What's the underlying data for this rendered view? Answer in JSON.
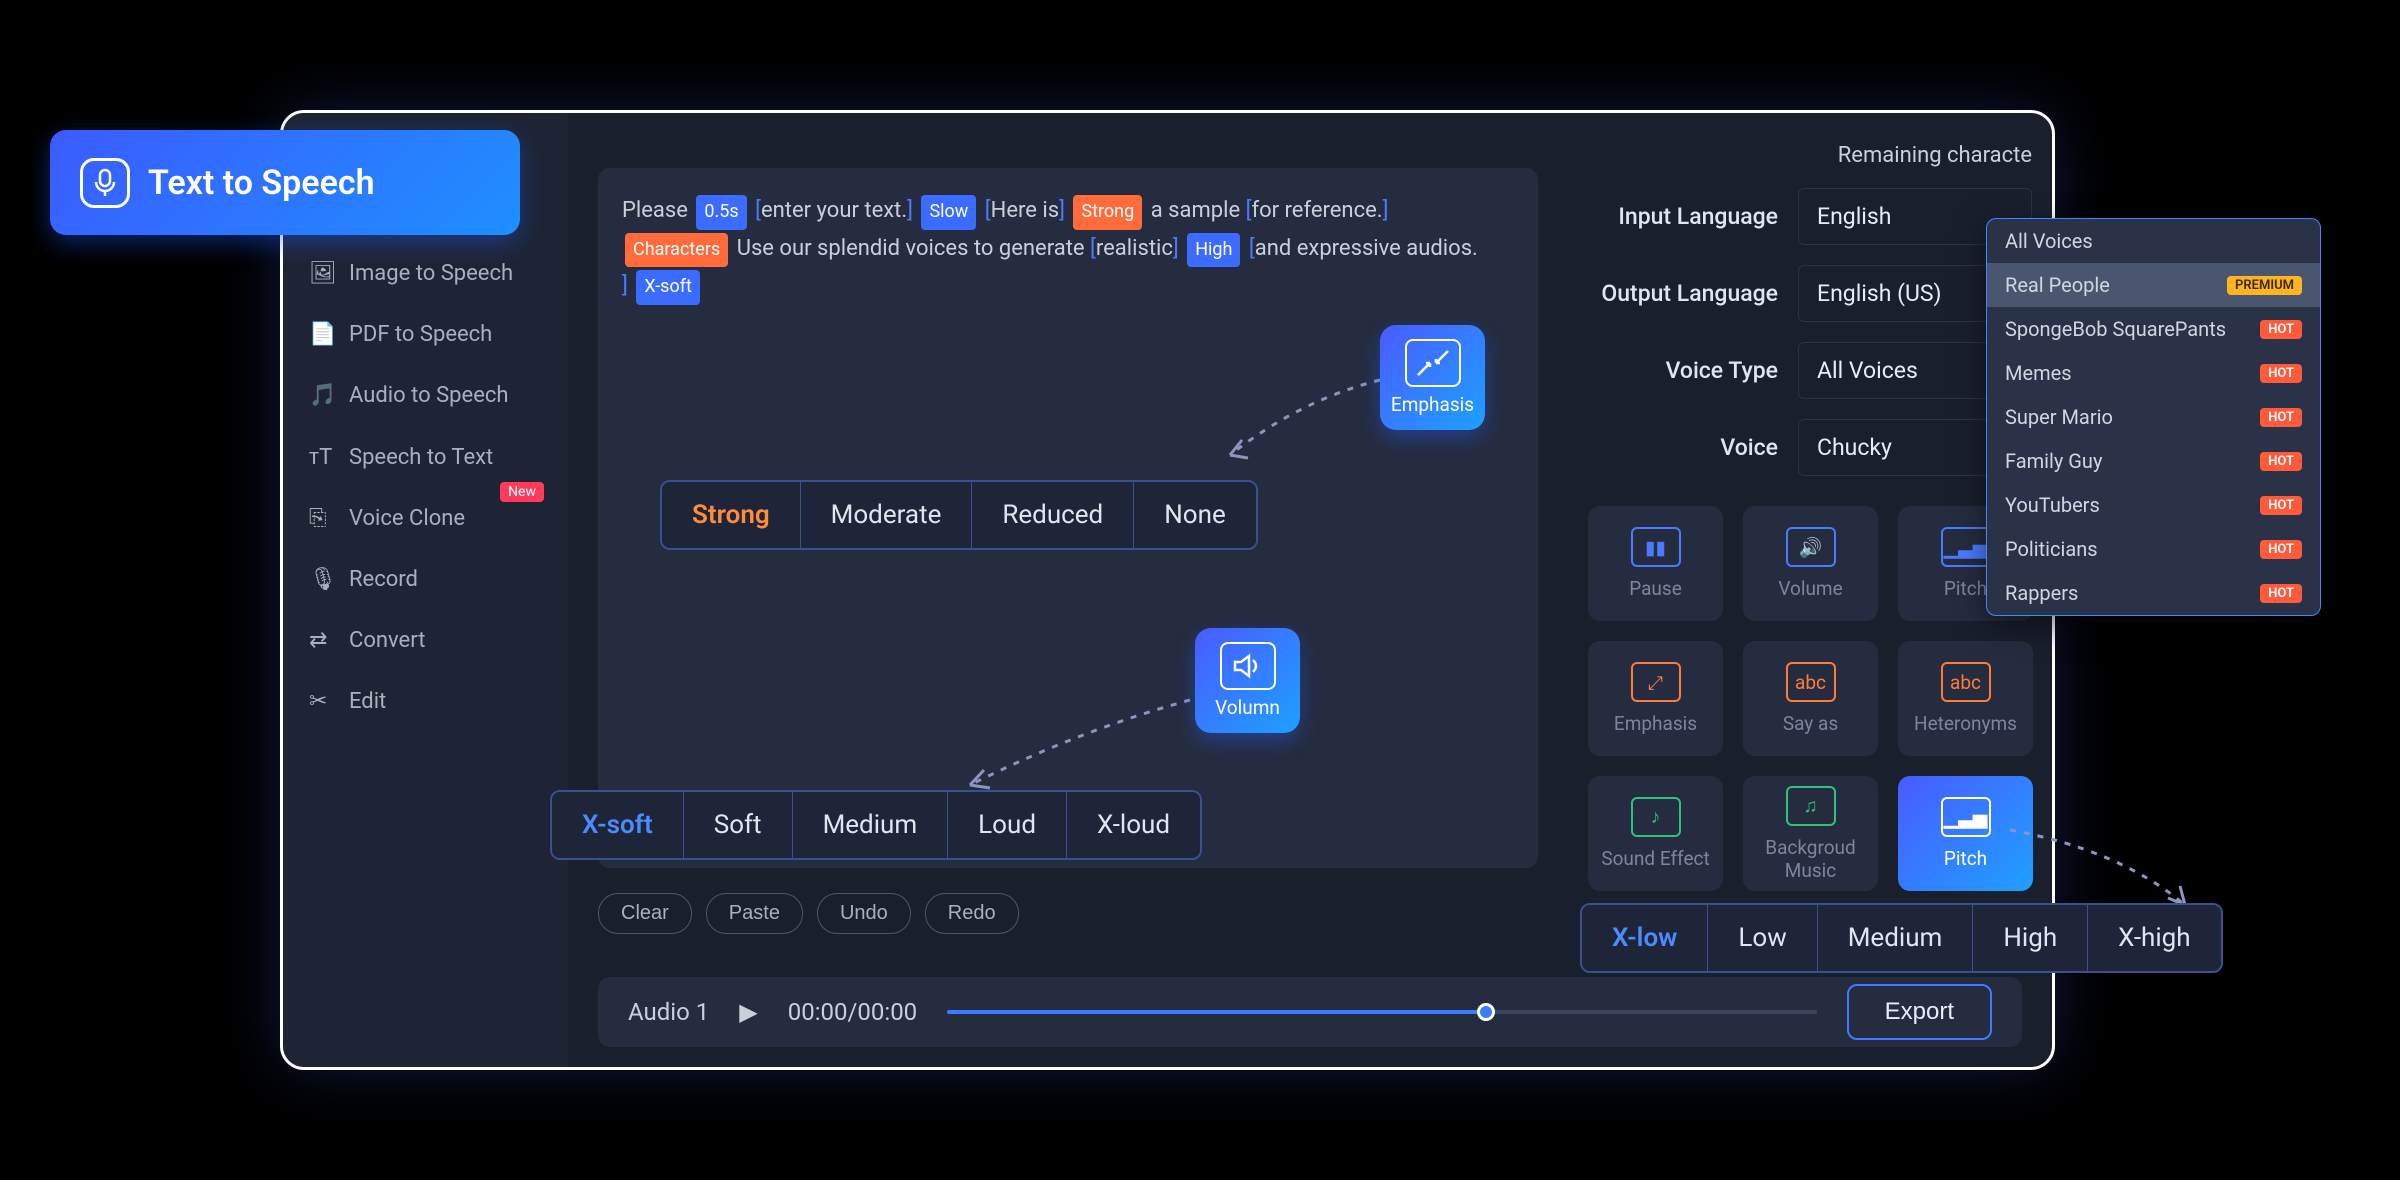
{
  "badge": {
    "label": "Text  to Speech"
  },
  "sidebar": {
    "items": [
      {
        "label": "Image to Speech"
      },
      {
        "label": "PDF to Speech"
      },
      {
        "label": "Audio to Speech"
      },
      {
        "label": "Speech to Text"
      },
      {
        "label": "Voice Clone",
        "badge": "New"
      },
      {
        "label": "Record"
      },
      {
        "label": "Convert"
      },
      {
        "label": "Edit"
      }
    ]
  },
  "editor": {
    "tokens": {
      "t0": "Please",
      "tag0": "0.5s",
      "t1": "enter your text.",
      "tag1": "Slow",
      "t2": "Here is",
      "tag2": "Strong",
      "t3": "a sample",
      "t4": "for reference.",
      "tag3": "Characters",
      "t5": "Use our splendid voices to generate",
      "t6": "realistic",
      "tag4": "High",
      "t7": "and expressive audios.",
      "tag5": "X-soft"
    }
  },
  "rightPanel": {
    "remaining": "Remaining characte",
    "fields": {
      "inputLang": {
        "label": "Input Language",
        "value": "English"
      },
      "outputLang": {
        "label": "Output Language",
        "value": "English (US)"
      },
      "voiceType": {
        "label": "Voice Type",
        "value": "All Voices"
      },
      "voice": {
        "label": "Voice",
        "value": "Chucky"
      }
    }
  },
  "tools": [
    {
      "label": "Pause"
    },
    {
      "label": "Volume"
    },
    {
      "label": "Pitch"
    },
    {
      "label": "Emphasis"
    },
    {
      "label": "Say as"
    },
    {
      "label": "Heteronyms"
    },
    {
      "label": "Sound Effect"
    },
    {
      "label": "Backgroud Music"
    },
    {
      "label": "Pitch"
    }
  ],
  "editorActions": [
    "Clear",
    "Paste",
    "Undo",
    "Redo"
  ],
  "audio": {
    "label": "Audio 1",
    "time": "00:00/00:00",
    "export": "Export"
  },
  "overlays": {
    "emphasis": {
      "title": "Emphasis",
      "options": [
        "Strong",
        "Moderate",
        "Reduced",
        "None"
      ]
    },
    "volume": {
      "title": "Volumn",
      "options": [
        "X-soft",
        "Soft",
        "Medium",
        "Loud",
        "X-loud"
      ]
    },
    "pitch": {
      "options": [
        "X-low",
        "Low",
        "Medium",
        "High",
        "X-high"
      ]
    }
  },
  "dropdown": {
    "items": [
      {
        "label": "All Voices"
      },
      {
        "label": "Real People",
        "badge": "PREMIUM",
        "badgeType": "premium",
        "selected": true
      },
      {
        "label": "SpongeBob SquarePants",
        "badge": "HOT",
        "badgeType": "hot"
      },
      {
        "label": "Memes",
        "badge": "HOT",
        "badgeType": "hot"
      },
      {
        "label": "Super Mario",
        "badge": "HOT",
        "badgeType": "hot"
      },
      {
        "label": "Family Guy",
        "badge": "HOT",
        "badgeType": "hot"
      },
      {
        "label": "YouTubers",
        "badge": "HOT",
        "badgeType": "hot"
      },
      {
        "label": "Politicians",
        "badge": "HOT",
        "badgeType": "hot"
      },
      {
        "label": "Rappers",
        "badge": "HOT",
        "badgeType": "hot"
      }
    ]
  }
}
